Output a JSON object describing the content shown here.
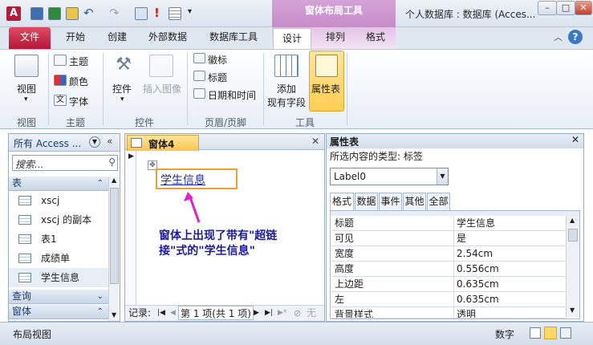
{
  "window": {
    "title": "个人数据库 : 数据库 (Acces...",
    "context_tab_group": "窗体布局工具",
    "controls": [
      "–",
      "□",
      "✕"
    ]
  },
  "ribbon_tabs": [
    "文件",
    "开始",
    "创建",
    "外部数据",
    "数据库工具",
    "设计",
    "排列",
    "格式"
  ],
  "ribbon": {
    "view_group": {
      "button": "视图",
      "label": "视图"
    },
    "theme_group": {
      "theme": "主题",
      "color": "颜色",
      "font": "字体",
      "label": "主题"
    },
    "controls_group": {
      "controls": "控件",
      "insert_image": "插入图像",
      "label": "控件"
    },
    "header_group": {
      "logo": "徽标",
      "title": "标题",
      "datetime": "日期和时间",
      "label": "页眉/页脚"
    },
    "tools_group": {
      "add_fields_1": "添加",
      "add_fields_2": "现有字段",
      "property_sheet": "属性表",
      "label": "工具"
    }
  },
  "nav_pane": {
    "header": "所有 Access ...",
    "search_placeholder": "搜索...",
    "sections": {
      "tables": "表",
      "queries": "查询",
      "forms": "窗体"
    },
    "items": [
      "xscj",
      "xscj 的副本",
      "表1",
      "成绩单",
      "学生信息"
    ]
  },
  "document": {
    "tab": "窗体4",
    "hyperlink_label": "学生信息",
    "annotation_line1": "窗体上出现了带有\"超链",
    "annotation_line2": "接\"式的\"学生信息\"",
    "record_nav": {
      "label": "记录:",
      "position": "第 1 项(共 1 项)",
      "filter": "无"
    }
  },
  "property_sheet": {
    "title": "属性表",
    "selection_type": "所选内容的类型: 标签",
    "selected_object": "Label0",
    "tabs": [
      "格式",
      "数据",
      "事件",
      "其他",
      "全部"
    ],
    "rows": [
      {
        "key": "标题",
        "value": "学生信息"
      },
      {
        "key": "可见",
        "value": "是"
      },
      {
        "key": "宽度",
        "value": "2.54cm"
      },
      {
        "key": "高度",
        "value": "0.556cm"
      },
      {
        "key": "上边距",
        "value": "0.635cm"
      },
      {
        "key": "左",
        "value": "0.635cm"
      },
      {
        "key": "背景样式",
        "value": "透明"
      }
    ]
  },
  "status_bar": {
    "view": "布局视图",
    "mode": "数字"
  },
  "colors": {
    "file_tab": "#c21f45",
    "context_band": "#c58ac8",
    "accent_blue": "#1b3b9e",
    "annotation": "#1a1aa6",
    "arrow": "#e020d0"
  }
}
